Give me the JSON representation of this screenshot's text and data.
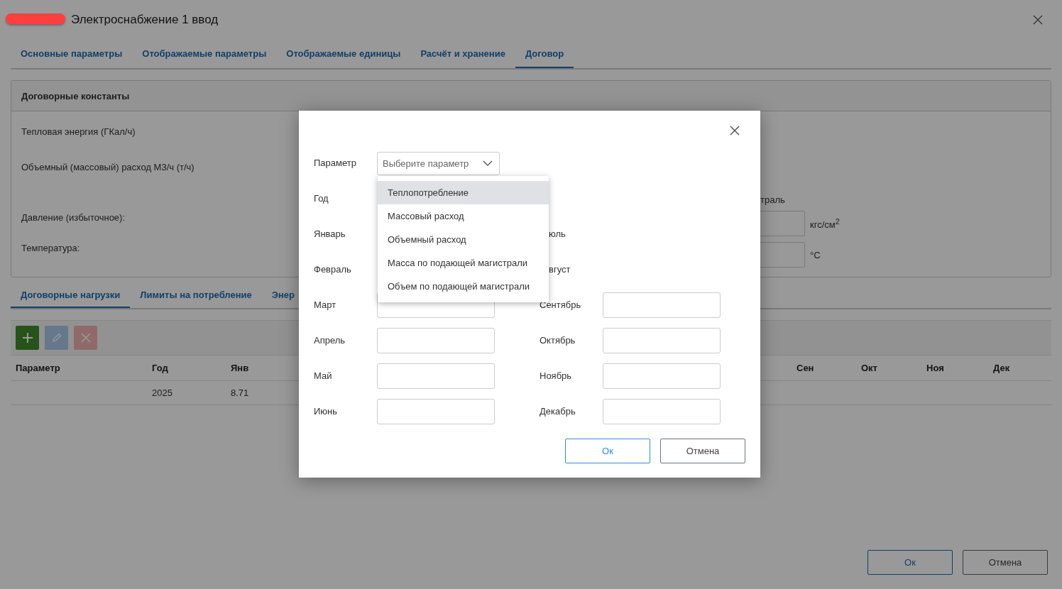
{
  "window": {
    "title": "Электроснабжение 1 ввод"
  },
  "tabs": [
    {
      "label": "Основные параметры",
      "selected": false
    },
    {
      "label": "Отображаемые параметры",
      "selected": false
    },
    {
      "label": "Отображаемые единицы",
      "selected": false
    },
    {
      "label": "Расчёт и хранение",
      "selected": false
    },
    {
      "label": "Договор",
      "selected": true
    }
  ],
  "constants": {
    "title": "Договорные константы",
    "labels": [
      "Тепловая энергия (ГКал/ч)",
      "Объемный (массовый) расход М3/ч (т/ч)",
      "Давление (избыточное):",
      "Температура:"
    ],
    "right_label": "траль",
    "units": [
      "кгс/см$^{2}$",
      "°С"
    ]
  },
  "subtabs": [
    {
      "label": "Договорные нагрузки",
      "selected": true
    },
    {
      "label": "Лимиты на потребление",
      "selected": false
    },
    {
      "label": "Энер",
      "selected": false
    }
  ],
  "toolbar": [
    {
      "kind": "add",
      "disabled": false
    },
    {
      "kind": "edit",
      "disabled": true
    },
    {
      "kind": "delete",
      "disabled": true
    }
  ],
  "table": {
    "columns": [
      "Параметр",
      "Год",
      "Янв",
      "Сен",
      "Окт",
      "Ноя",
      "Дек"
    ],
    "rows": [
      [
        "",
        "2025",
        "8.71",
        "",
        "",
        "",
        ""
      ]
    ]
  },
  "buttons": [
    "Ок",
    "Отмена"
  ],
  "dialog": {
    "param_label": "Параметр",
    "select_placeholder": "Выберите параметр",
    "year_label": "Год",
    "left": [
      {
        "label": "Январь",
        "kind": "label"
      },
      {
        "label": "Февраль",
        "kind": "label"
      },
      {
        "label": "Март",
        "kind": "field"
      },
      {
        "label": "Апрель",
        "kind": "field"
      },
      {
        "label": "Май",
        "kind": "field"
      },
      {
        "label": "Июнь",
        "kind": "field"
      }
    ],
    "right": [
      {
        "label": "юль",
        "kind": "covered"
      },
      {
        "label": "вгуст",
        "kind": "covered"
      },
      {
        "label": "Сентябрь",
        "kind": "field"
      },
      {
        "label": "Октябрь",
        "kind": "field"
      },
      {
        "label": "Ноябрь",
        "kind": "field"
      },
      {
        "label": "Декабрь",
        "kind": "field"
      }
    ],
    "options": [
      {
        "label": "Теплопотребление",
        "highlighted": true
      },
      {
        "label": "Массовый расход",
        "highlighted": false
      },
      {
        "label": "Объемный расход",
        "highlighted": false
      },
      {
        "label": "Масса по подающей магистрали",
        "highlighted": false
      },
      {
        "label": "Объем по подающей магистрали",
        "highlighted": false
      }
    ],
    "buttons": [
      "Ок",
      "Отмена"
    ]
  }
}
